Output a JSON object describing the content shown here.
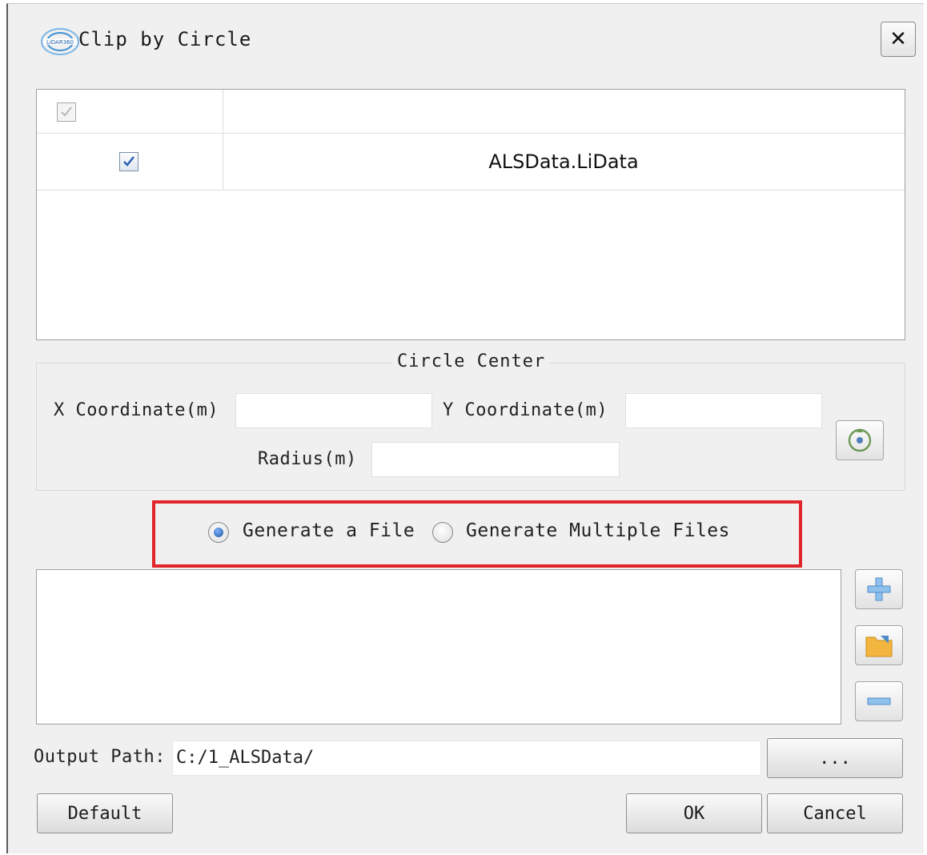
{
  "window": {
    "title": "Clip by Circle",
    "close_symbol": "✕"
  },
  "layers": {
    "header_checked": true,
    "rows": [
      {
        "checked": true,
        "name": "ALSData.LiData"
      }
    ]
  },
  "circle_center": {
    "group_title": "Circle Center",
    "x_label": "X Coordinate(m)",
    "x_value": "",
    "y_label": "Y Coordinate(m)",
    "y_value": "",
    "radius_label": "Radius(m)",
    "radius_value": ""
  },
  "output_mode": {
    "options": [
      {
        "label": "Generate a File",
        "selected": true
      },
      {
        "label": "Generate Multiple Files",
        "selected": false
      }
    ]
  },
  "output": {
    "label": "Output Path:",
    "path": "C:/1_ALSData/",
    "browse_label": "..."
  },
  "buttons": {
    "default": "Default",
    "ok": "OK",
    "cancel": "Cancel"
  },
  "colors": {
    "highlight": "#e1262b",
    "check": "#2b5fb4"
  }
}
